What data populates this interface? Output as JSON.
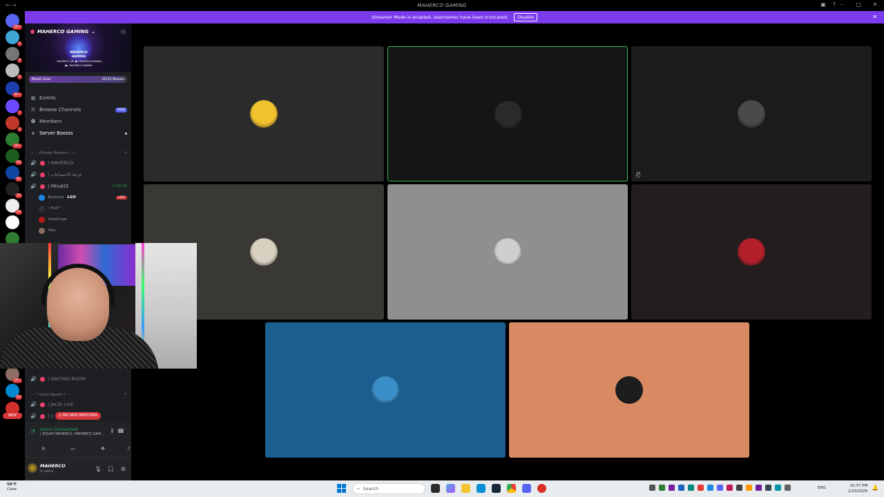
{
  "window": {
    "title": "MAHERCO GAMING"
  },
  "banner": {
    "message": "Streamer Mode is enabled. Usernames have been truncated.",
    "disable_label": "Disable"
  },
  "rail": {
    "servers": [
      {
        "name": "home",
        "badge": "1K+",
        "color": "#5865f2"
      },
      {
        "name": "server-2",
        "badge": "1",
        "color": "#3fa7d6"
      },
      {
        "name": "server-3",
        "badge": "4",
        "color": "#777777"
      },
      {
        "name": "server-4",
        "badge": "2",
        "color": "#bbbbbb"
      },
      {
        "name": "server-5",
        "badge": "2K+",
        "color": "#1e40af"
      },
      {
        "name": "server-6",
        "badge": "7",
        "color": "#6d4aff"
      },
      {
        "name": "server-7",
        "badge": "5",
        "color": "#c0392b"
      },
      {
        "name": "server-8",
        "badge": "1K+",
        "color": "#2e7d32"
      },
      {
        "name": "server-9",
        "badge": "98",
        "color": "#1b5e20"
      },
      {
        "name": "server-10",
        "badge": "61",
        "color": "#0d47a1"
      },
      {
        "name": "server-11",
        "badge": "20",
        "color": "#222222"
      },
      {
        "name": "server-12",
        "badge": "26",
        "color": "#eeeeee"
      },
      {
        "name": "server-13",
        "badge": "",
        "color": "#ffffff"
      },
      {
        "name": "server-14",
        "badge": "17",
        "color": "#2e7d32"
      },
      {
        "name": "server-15",
        "badge": "1K+",
        "color": "#8d6e63"
      },
      {
        "name": "server-16",
        "badge": "63",
        "color": "#0288d1"
      },
      {
        "name": "server-17",
        "badge": "8K+",
        "color": "#d32f2f"
      }
    ],
    "new_label": "NEW"
  },
  "sidebar": {
    "server_name": "MAHERCO GAMING",
    "logo_lines": [
      "MAHERCO",
      "GAMING",
      "/ MAHERCO_ME  ● / MAHERCOGAMING",
      "● / MAHERCO GAMING"
    ],
    "boost": {
      "label": "Boost Goal",
      "value": "25/31 Boosts"
    },
    "menu": [
      {
        "icon": "calendar-icon",
        "label": "Events",
        "pill": ""
      },
      {
        "icon": "browse-icon",
        "label": "Browse Channels",
        "pill": "NEW"
      },
      {
        "icon": "members-icon",
        "label": "Members",
        "pill": ""
      },
      {
        "icon": "boost-icon",
        "label": "Server Boosts",
        "pill": ""
      }
    ],
    "categories": [
      {
        "label": "—｛ •Private Rooms• ｝— ·",
        "plus": "+"
      },
      {
        "label": "—｛ •Lives Squad• ｝— ·",
        "plus": "+"
      }
    ],
    "voice_channels": [
      {
        "name": "| MAHERCO",
        "timer": ""
      },
      {
        "name": "| غرفة الاجتماعات",
        "timer": ""
      },
      {
        "name": "| PRIVATE",
        "timer": "1:20:35"
      },
      {
        "name": "| WAITING ROOM",
        "timer": ""
      },
      {
        "name": "| JALTA LIVE",
        "timer": ""
      },
      {
        "name": "| C",
        "timer": ""
      }
    ],
    "members": [
      {
        "name": "Bustanji",
        "tag": "LGO",
        "live": "LIVE",
        "color": "#1e88e5"
      },
      {
        "name": "! Evil™",
        "tag": "",
        "live": "",
        "color": "#333333"
      },
      {
        "name": "Greetings",
        "tag": "",
        "live": "",
        "color": "#b71c1c"
      },
      {
        "name": "Hex",
        "tag": "",
        "live": "",
        "color": "#8d6e63"
      }
    ],
    "mentions_label": "2,360 NEW MENTIONS"
  },
  "voice": {
    "status": "Voice Connected",
    "channel": "| SQUAD MAHERCO / MAHERCO GAM..."
  },
  "user": {
    "name": "MAHERCO",
    "status": "In voice"
  },
  "tiles": [
    {
      "name": "tile-1",
      "bg": "#2b2b2b",
      "avatar": "#f2c12e",
      "speaking": false,
      "muted": false
    },
    {
      "name": "tile-2",
      "bg": "#141614",
      "avatar": "#2a2a2a",
      "speaking": true,
      "muted": false
    },
    {
      "name": "tile-3",
      "bg": "#1c1c1c",
      "avatar": "#4a4a4a",
      "speaking": false,
      "muted": true
    },
    {
      "name": "tile-4",
      "bg": "#3a3835",
      "avatar": "#d8d0c0",
      "speaking": false,
      "muted": false
    },
    {
      "name": "tile-5",
      "bg": "#8f8f8f",
      "avatar": "#cfcfcf",
      "speaking": false,
      "muted": false
    },
    {
      "name": "tile-6",
      "bg": "#231d1d",
      "avatar": "#b3202a",
      "speaking": false,
      "muted": false
    },
    {
      "name": "tile-7",
      "bg": "#1a5f8f",
      "avatar": "#3b8fc8",
      "speaking": false,
      "muted": false
    },
    {
      "name": "tile-8",
      "bg": "#d98a62",
      "avatar": "#1d1d1d",
      "speaking": false,
      "muted": false
    }
  ],
  "taskbar": {
    "weather_temp": "58°F",
    "weather_desc": "Clear",
    "search_placeholder": "Search",
    "time": "10:37 PM",
    "date": "2/20/2026",
    "lang": "ENG"
  }
}
